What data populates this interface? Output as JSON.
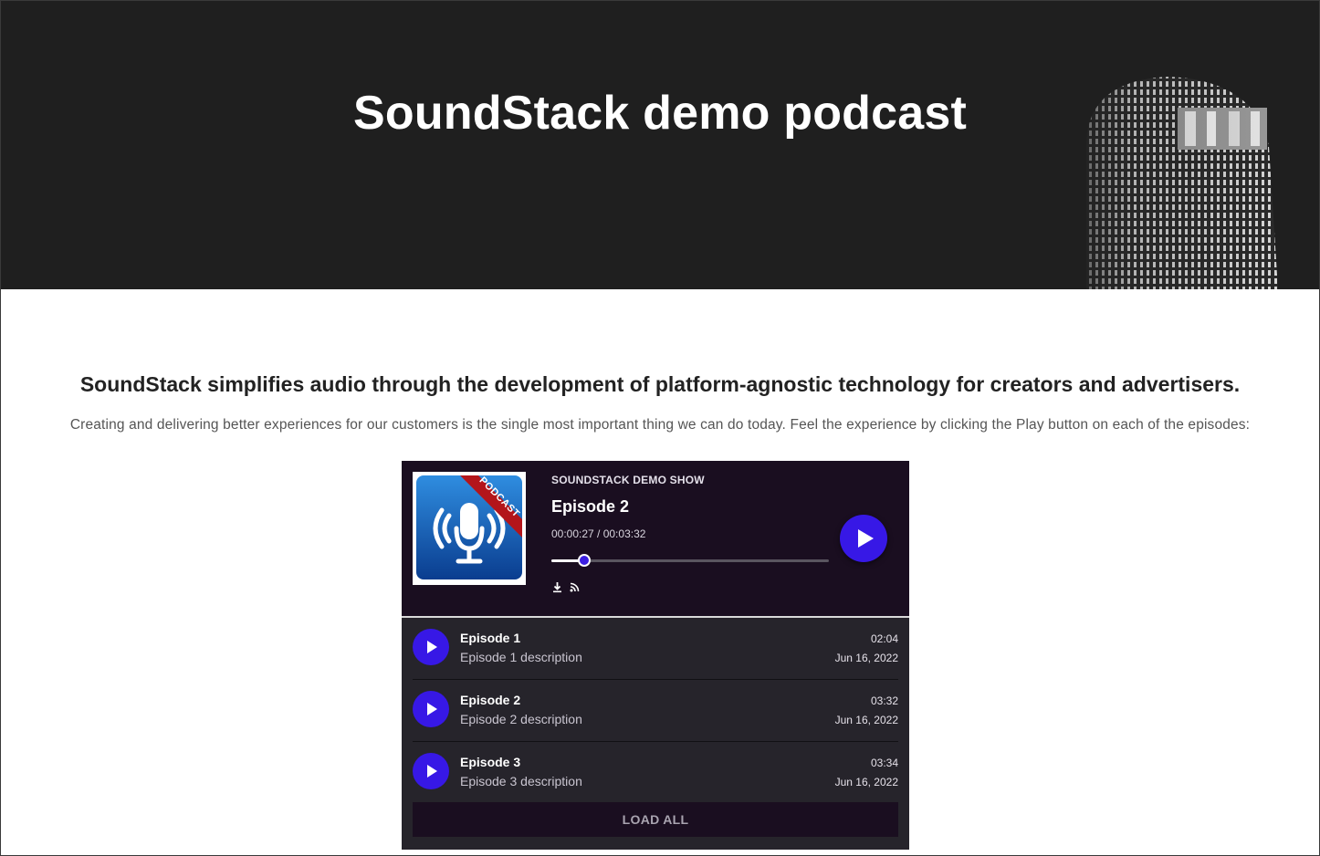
{
  "hero": {
    "title": "SoundStack demo podcast"
  },
  "intro": {
    "headline": "SoundStack simplifies audio through the development of platform-agnostic technology for creators and advertisers.",
    "subline": "Creating and delivering better experiences for our customers is the single most important thing we can do today. Feel the experience by clicking the Play button on each of the episodes:"
  },
  "player": {
    "cover_badge": "PODCAST",
    "show_name": "SOUNDSTACK DEMO SHOW",
    "episode_title": "Episode 2",
    "time": "00:00:27 / 00:03:32",
    "progress_fraction": 0.12,
    "icons": [
      "download-icon",
      "rss-icon",
      "play-icon"
    ],
    "accent_color": "#3718e6",
    "episodes": [
      {
        "title": "Episode 1",
        "description": "Episode 1 description",
        "duration": "02:04",
        "date": "Jun 16, 2022"
      },
      {
        "title": "Episode 2",
        "description": "Episode 2 description",
        "duration": "03:32",
        "date": "Jun 16, 2022"
      },
      {
        "title": "Episode 3",
        "description": "Episode 3 description",
        "duration": "03:34",
        "date": "Jun 16, 2022"
      }
    ],
    "load_all_label": "LOAD ALL"
  }
}
